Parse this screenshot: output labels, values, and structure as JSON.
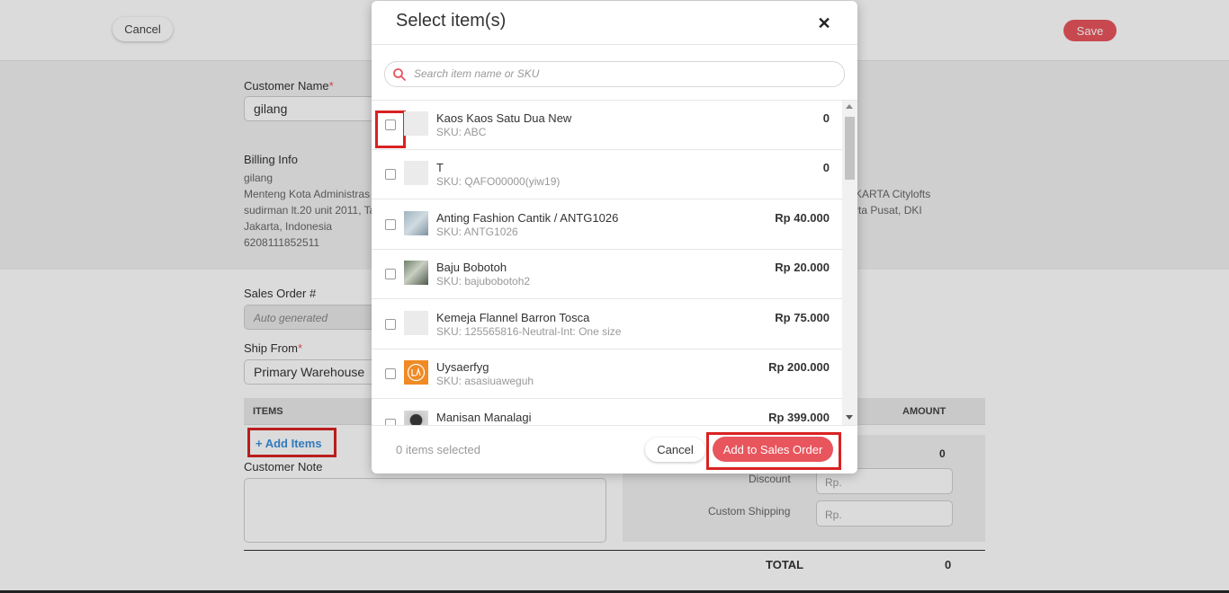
{
  "topbar": {
    "cancel_label": "Cancel",
    "save_label": "Save"
  },
  "form": {
    "customer_name_label": "Customer Name",
    "required_mark": "*",
    "customer_name_value": "gilang",
    "billing_label": "Billing Info",
    "billing_lines": [
      "gilang",
      "Menteng Kota Administras",
      "sudirman lt.20 unit 2011, Ta",
      "Jakarta, Indonesia",
      "6208111852511"
    ],
    "shipping_lines": [
      "KARTA Citylofts",
      "rta Pusat, DKI"
    ],
    "so_label": "Sales Order #",
    "so_placeholder": "Auto generated",
    "ship_from_label": "Ship From",
    "ship_from_value": "Primary Warehouse",
    "items_header": "ITEMS",
    "amount_header": "AMOUNT",
    "add_items_label": "+ Add Items",
    "customer_note_label": "Customer Note",
    "subtotal_value": "0",
    "discount_label": "Discount",
    "discount_placeholder": "Rp.",
    "shipping_label": "Custom Shipping",
    "shipping_placeholder": "Rp.",
    "total_label": "TOTAL",
    "total_value": "0"
  },
  "modal": {
    "title": "Select item(s)",
    "close_icon": "close-icon",
    "search_placeholder": "Search item name or SKU",
    "items": [
      {
        "name": "Kaos Kaos Satu Dua New",
        "sku": "SKU: ABC",
        "price": "0"
      },
      {
        "name": "T",
        "sku": "SKU: QAFO00000(yiw19)",
        "price": "0"
      },
      {
        "name": "Anting Fashion Cantik / ANTG1026",
        "sku": "SKU: ANTG1026",
        "price": "Rp 40.000"
      },
      {
        "name": "Baju Bobotoh",
        "sku": "SKU: bajubobotoh2",
        "price": "Rp 20.000"
      },
      {
        "name": "Kemeja Flannel Barron Tosca",
        "sku": "SKU: 125565816-Neutral-Int: One size",
        "price": "Rp 75.000"
      },
      {
        "name": "Uysaerfyg",
        "sku": "SKU: asasiuaweguh",
        "price": "Rp 200.000"
      },
      {
        "name": "Manisan Manalagi",
        "sku": "",
        "price": "Rp 399.000"
      }
    ],
    "selected_count": "0 items selected",
    "cancel_label": "Cancel",
    "add_label": "Add to Sales Order",
    "accent_color": "#e8555d",
    "highlight_color": "#d92222"
  }
}
